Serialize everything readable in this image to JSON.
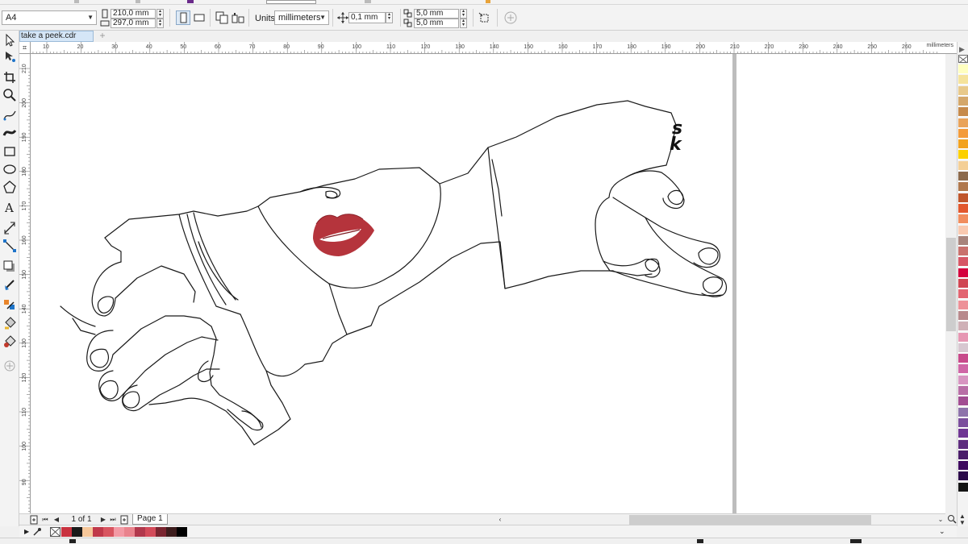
{
  "propbar": {
    "page_size": "A4",
    "width_value": "210,0 mm",
    "height_value": "297,0 mm",
    "units_label": "Units:",
    "units_value": "millimeters",
    "nudge_value": "0,1 mm",
    "dup_x_value": "5,0 mm",
    "dup_y_value": "5,0 mm"
  },
  "tabs": {
    "document_tab": "take a peek.cdr",
    "add_tab": "+"
  },
  "ruler": {
    "h_labels": [
      "10",
      "20",
      "30",
      "40",
      "50",
      "60",
      "70",
      "80",
      "90",
      "100",
      "110",
      "120",
      "130",
      "140",
      "150",
      "160",
      "170",
      "180",
      "190",
      "200",
      "210",
      "220",
      "230",
      "240",
      "250",
      "260"
    ],
    "v_labels": [
      "210",
      "200",
      "190",
      "180",
      "170",
      "160",
      "150",
      "140",
      "130",
      "120",
      "110",
      "100",
      "90"
    ],
    "unit": "millimeters"
  },
  "canvas": {
    "signature": "sk",
    "lips_color": "#b5343c"
  },
  "nav": {
    "page_count": "1 of 1",
    "page_tab": "Page 1"
  },
  "palette": {
    "colors": [
      "#ffffc0",
      "#f5e39b",
      "#e8c98a",
      "#d4a76a",
      "#c68a4b",
      "#e9a35a",
      "#f39b3a",
      "#f2a21f",
      "#fcd000",
      "#f4cf96",
      "#8c6a4c",
      "#b0784d",
      "#c0562c",
      "#e2582e",
      "#f18d5e",
      "#f9c9b0",
      "#a7837b",
      "#c9716d",
      "#d65766",
      "#d4003d",
      "#d04653",
      "#e26571",
      "#ed9198",
      "#b8898c",
      "#cfb0b6",
      "#e697b3",
      "#d7c7d0",
      "#c84a8b",
      "#cf66a6",
      "#d795c1",
      "#b86ea6",
      "#a24d92",
      "#8e73ab",
      "#7b4e9d",
      "#6f3693",
      "#5e2d7f",
      "#4a1d6a",
      "#3e0a5f",
      "#2b0a4a",
      "#151515"
    ],
    "doc_colors": [
      "#ffffff",
      "#c9323f",
      "#1a1a1a",
      "#f6c79a",
      "#c0394a",
      "#d85560",
      "#f39aa5",
      "#e9838d",
      "#b1384c",
      "#d34b5a",
      "#7a2530",
      "#3d1d1d",
      "#000000"
    ]
  }
}
